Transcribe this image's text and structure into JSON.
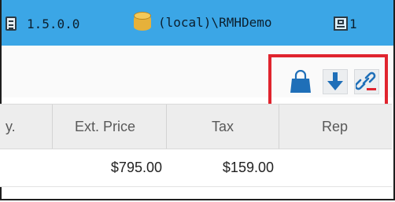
{
  "statusbar": {
    "version": "1.5.0.0",
    "database": "(local)\\RMHDemo",
    "user_count": "1"
  },
  "toolbar": {
    "icons": [
      "shopping-bag-icon",
      "download-arrow-icon",
      "unlink-icon"
    ],
    "highlight_color": "#e0242e"
  },
  "grid": {
    "columns": [
      "y.",
      "Ext. Price",
      "Tax",
      "Rep"
    ],
    "rows": [
      {
        "qty": "",
        "ext_price": "$795.00",
        "tax": "$159.00",
        "rep": ""
      }
    ]
  },
  "colors": {
    "accent": "#3ba6e6",
    "download": "#1f6fb8"
  }
}
